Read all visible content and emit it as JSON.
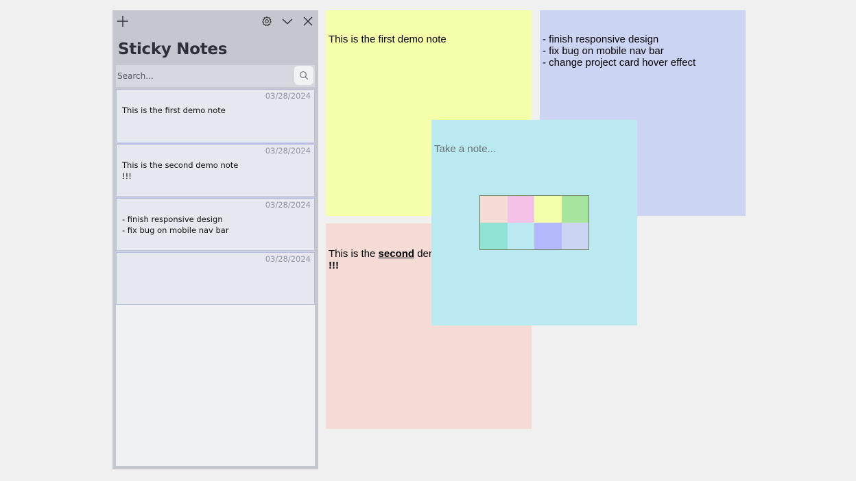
{
  "sidebar": {
    "title": "Sticky Notes",
    "search_placeholder": "Search...",
    "toolbar": {
      "add_icon": "plus-icon",
      "settings_icon": "gear-icon",
      "collapse_icon": "chevron-down-icon",
      "close_icon": "close-icon"
    },
    "notes": [
      {
        "date": "03/28/2024",
        "text": "This is the first demo note"
      },
      {
        "date": "03/28/2024",
        "text": "This is the second demo note\n!!!"
      },
      {
        "date": "03/28/2024",
        "text": "- finish responsive design\n- fix bug on mobile nav bar"
      },
      {
        "date": "03/28/2024",
        "text": ""
      }
    ]
  },
  "stickies": {
    "yellow": {
      "color": "#f5fea8",
      "text": "This is the first demo note"
    },
    "lavender": {
      "color": "#ccd4f4",
      "text": "- finish responsive design\n- fix bug on mobile nav bar\n- change project card hover effect"
    },
    "pink": {
      "color": "#f4dbd6",
      "text_prefix": "This is the ",
      "text_bold": "second",
      "text_suffix": " demo note",
      "text_line2": "!!!"
    },
    "new_note": {
      "color": "#bae9f1",
      "placeholder": "Take a note..."
    }
  },
  "palette": {
    "colors": [
      "#f4dbd6",
      "#f4c1e7",
      "#f5fea8",
      "#a7e49e",
      "#90e2d4",
      "#bae9f1",
      "#b3b8fd",
      "#ccd4f4"
    ]
  }
}
